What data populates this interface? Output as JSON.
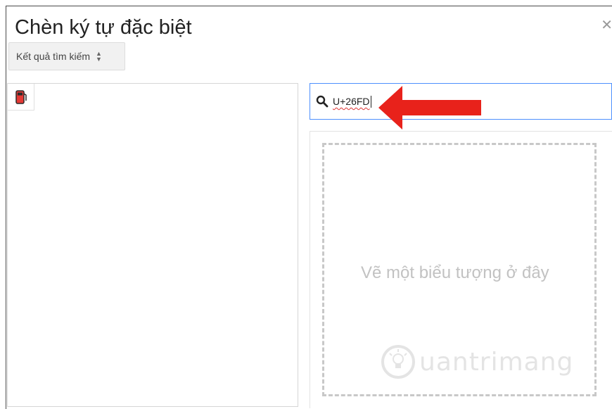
{
  "dialog": {
    "title": "Chèn ký tự đặc biệt",
    "close_icon": "close-icon"
  },
  "filter": {
    "selected": "Kết quả tìm kiếm",
    "icon": "sort-arrows-icon"
  },
  "results": {
    "items": [
      {
        "char": "⛽",
        "icon": "fuel-pump-icon",
        "color": "#e53935"
      }
    ]
  },
  "search": {
    "value": "U+26FD",
    "icon": "search-icon"
  },
  "draw": {
    "hint": "Vẽ một biểu tượng ở đây"
  },
  "watermark": {
    "text": "uantrimang",
    "icon": "lightbulb-logo-icon"
  },
  "colors": {
    "accent": "#4d90fe",
    "annotation_arrow": "#e8221b"
  }
}
